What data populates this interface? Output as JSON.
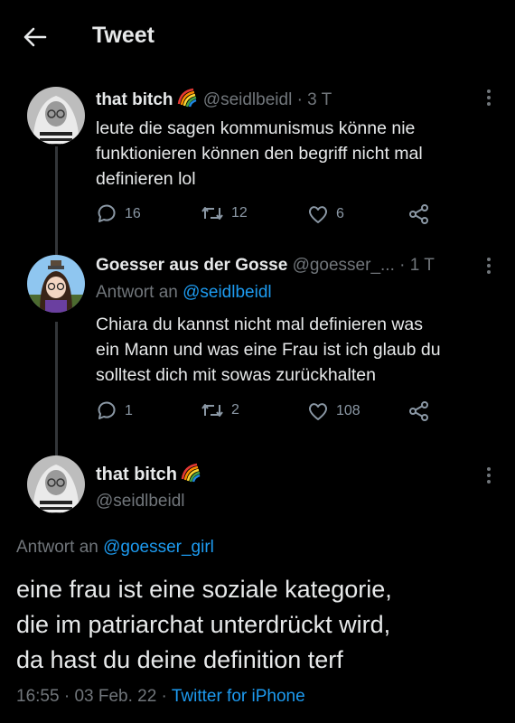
{
  "header": {
    "title": "Tweet"
  },
  "tweets": [
    {
      "name": "that bitch",
      "handle": "@seidlbeidl",
      "time": "· 3 T",
      "text_lines": [
        "leute die sagen kommunismus könne nie",
        "funktionieren können den begriff nicht mal",
        "definieren lol"
      ],
      "replies": "16",
      "retweets": "12",
      "likes": "6"
    },
    {
      "name": "Goesser aus der Gosse",
      "handle": "@goesser_...",
      "time": "· 1 T",
      "reply_prefix": "Antwort an",
      "reply_to": "@seidlbeidl",
      "text_lines": [
        "Chiara du kannst nicht mal definieren was",
        "ein Mann und was eine Frau ist ich glaub du",
        "solltest dich mit sowas zurückhalten"
      ],
      "replies": "1",
      "retweets": "2",
      "likes": "108"
    }
  ],
  "main": {
    "name": "that bitch",
    "handle": "@seidlbeidl",
    "reply_prefix": "Antwort an",
    "reply_to": "@goesser_girl",
    "text_lines": [
      "eine frau ist eine soziale kategorie,",
      "die im patriarchat unterdrückt wird,",
      "da hast du deine definition terf"
    ],
    "time": "16:55",
    "date": "03 Feb. 22",
    "source": "Twitter for iPhone"
  },
  "colors": {
    "background": "#000000",
    "text": "#e7e9ea",
    "secondary": "#71767b",
    "link": "#1d9bf0"
  }
}
